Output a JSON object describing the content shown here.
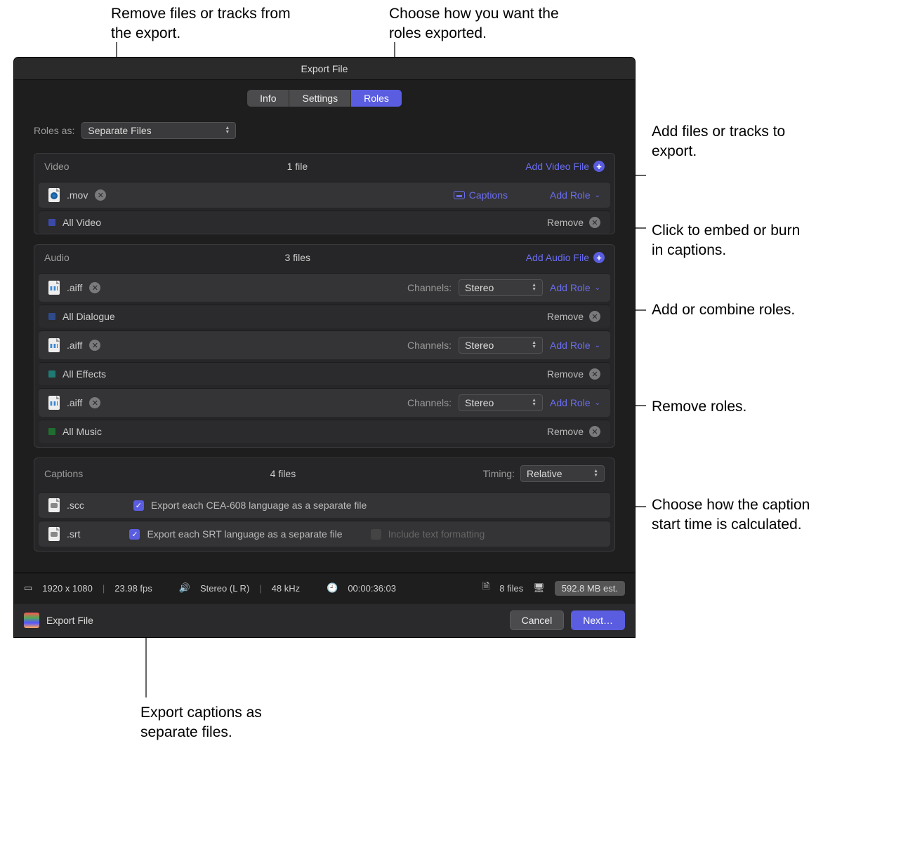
{
  "annotations": {
    "remove_files": "Remove files or tracks from the export.",
    "choose_roles": "Choose how you want the roles exported.",
    "add_files": "Add files or tracks to export.",
    "captions_embed": "Click to embed or burn in captions.",
    "add_combine": "Add or combine roles.",
    "remove_roles": "Remove roles.",
    "timing": "Choose how the caption start time is calculated.",
    "export_captions": "Export captions as separate files."
  },
  "window_title": "Export File",
  "tabs": {
    "info": "Info",
    "settings": "Settings",
    "roles": "Roles"
  },
  "roles_as_label": "Roles as:",
  "roles_as_value": "Separate Files",
  "video": {
    "title": "Video",
    "count": "1 file",
    "add": "Add Video File",
    "file_ext": ".mov",
    "captions": "Captions",
    "add_role": "Add Role",
    "role1": {
      "swatch": "#3b4aa8",
      "name": "All Video",
      "remove": "Remove"
    }
  },
  "audio": {
    "title": "Audio",
    "count": "3 files",
    "add": "Add Audio File",
    "channels_label": "Channels:",
    "channels_value": "Stereo",
    "add_role": "Add Role",
    "file_ext": ".aiff",
    "roles": [
      {
        "swatch": "#2e4a8a",
        "name": "All Dialogue",
        "remove": "Remove"
      },
      {
        "swatch": "#1f7a73",
        "name": "All Effects",
        "remove": "Remove"
      },
      {
        "swatch": "#1f6e2f",
        "name": "All Music",
        "remove": "Remove"
      }
    ]
  },
  "captions": {
    "title": "Captions",
    "count": "4 files",
    "timing_label": "Timing:",
    "timing_value": "Relative",
    "scc_ext": ".scc",
    "scc_label": "Export each CEA-608 language as a separate file",
    "srt_ext": ".srt",
    "srt_label": "Export each SRT language as a separate file",
    "include_fmt": "Include text formatting"
  },
  "status": {
    "res": "1920 x 1080",
    "fps": "23.98 fps",
    "audio": "Stereo (L R)",
    "khz": "48 kHz",
    "duration": "00:00:36:03",
    "files": "8 files",
    "size": "592.8 MB est."
  },
  "footer": {
    "title": "Export File",
    "cancel": "Cancel",
    "next": "Next…"
  }
}
